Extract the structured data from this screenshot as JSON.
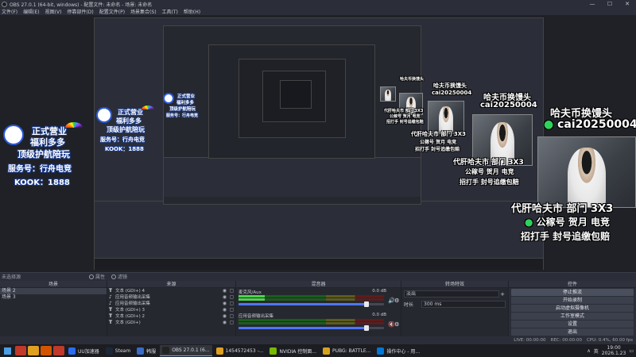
{
  "window": {
    "title": "OBS 27.0.1 (64-bit, windows) - 配置文件: 未命名 - 场景: 未命名",
    "controls": [
      "—",
      "☐",
      "✕"
    ]
  },
  "menu": [
    "文件(F)",
    "编辑(E)",
    "视图(V)",
    "停靠部件(D)",
    "配置文件(P)",
    "场景集合(S)",
    "工具(T)",
    "帮助(H)"
  ],
  "preview": {
    "promo_lines": {
      "exchange": "哈夫币换馒头",
      "wechat": "cai20250004",
      "line1": "代肝哈夫市 部门 3X3",
      "line2": "公稼号 贺月 电竞",
      "line3": "招打手 封号追缴包赔"
    },
    "badge": {
      "line1": "正式营业",
      "line2": "福利多多",
      "line3": "顶级护航陪玩",
      "line4": "服务号：行舟电竞",
      "line5": "KOOK：1888"
    }
  },
  "source_toolbar": {
    "no_source": "未选择源",
    "properties": "属性",
    "filters": "滤镜"
  },
  "docks": {
    "scenes": {
      "title": "场景",
      "items": [
        "场景 2",
        "场景 3"
      ],
      "footer": [
        "+",
        "—",
        "∧",
        "∨"
      ]
    },
    "sources": {
      "title": "来源",
      "items": [
        "文本 (GDI+) 4",
        "应用音频输出采集",
        "应用音频输出采集",
        "文本 (GDI+) 3",
        "文本 (GDI+) 2",
        "文本 (GDI+)"
      ],
      "footer": [
        "+",
        "—",
        "⚙",
        "∧",
        "∨"
      ]
    },
    "mixer": {
      "title": "混音器",
      "channels": [
        {
          "name": "麦克风/Aux",
          "db": "0.0 dB",
          "level": 0.18,
          "volume": 0.88,
          "muted": false
        },
        {
          "name": "应用音频输出采集",
          "db": "0.0 dB",
          "level": 0.0,
          "volume": 0.88,
          "muted": true
        }
      ]
    },
    "transitions": {
      "title": "转场特效",
      "type": "淡出",
      "duration_label": "时长",
      "duration": "300 ms"
    },
    "controls": {
      "title": "控件",
      "buttons": [
        "停止推流",
        "开始录制",
        "启动虚拟摄像机",
        "工作室模式",
        "设置",
        "退出"
      ]
    }
  },
  "status": {
    "live": "LIVE: 00:00:00",
    "rec": "REC: 00:00:00",
    "cpu": "CPU: 0.4%, 60.00 fps"
  },
  "taskbar": {
    "apps": [
      {
        "label": "UU加速器",
        "color": "#2a6df4"
      },
      {
        "label": "Steam",
        "color": "#1b2838"
      },
      {
        "label": "韩服",
        "color": "#3a6cc8"
      },
      {
        "label": "OBS 27.0.1 (6...",
        "color": "#222"
      },
      {
        "label": "1454572453 -...",
        "color": "#e0a020"
      },
      {
        "label": "NVIDIA 控制面...",
        "color": "#76b900"
      },
      {
        "label": "PUBG: BATTLE...",
        "color": "#d6a21e"
      },
      {
        "label": "操作中心 - 用...",
        "color": "#0078d7"
      }
    ],
    "tray_lang": "英",
    "time": "19:00",
    "date": "2026.1.23"
  }
}
